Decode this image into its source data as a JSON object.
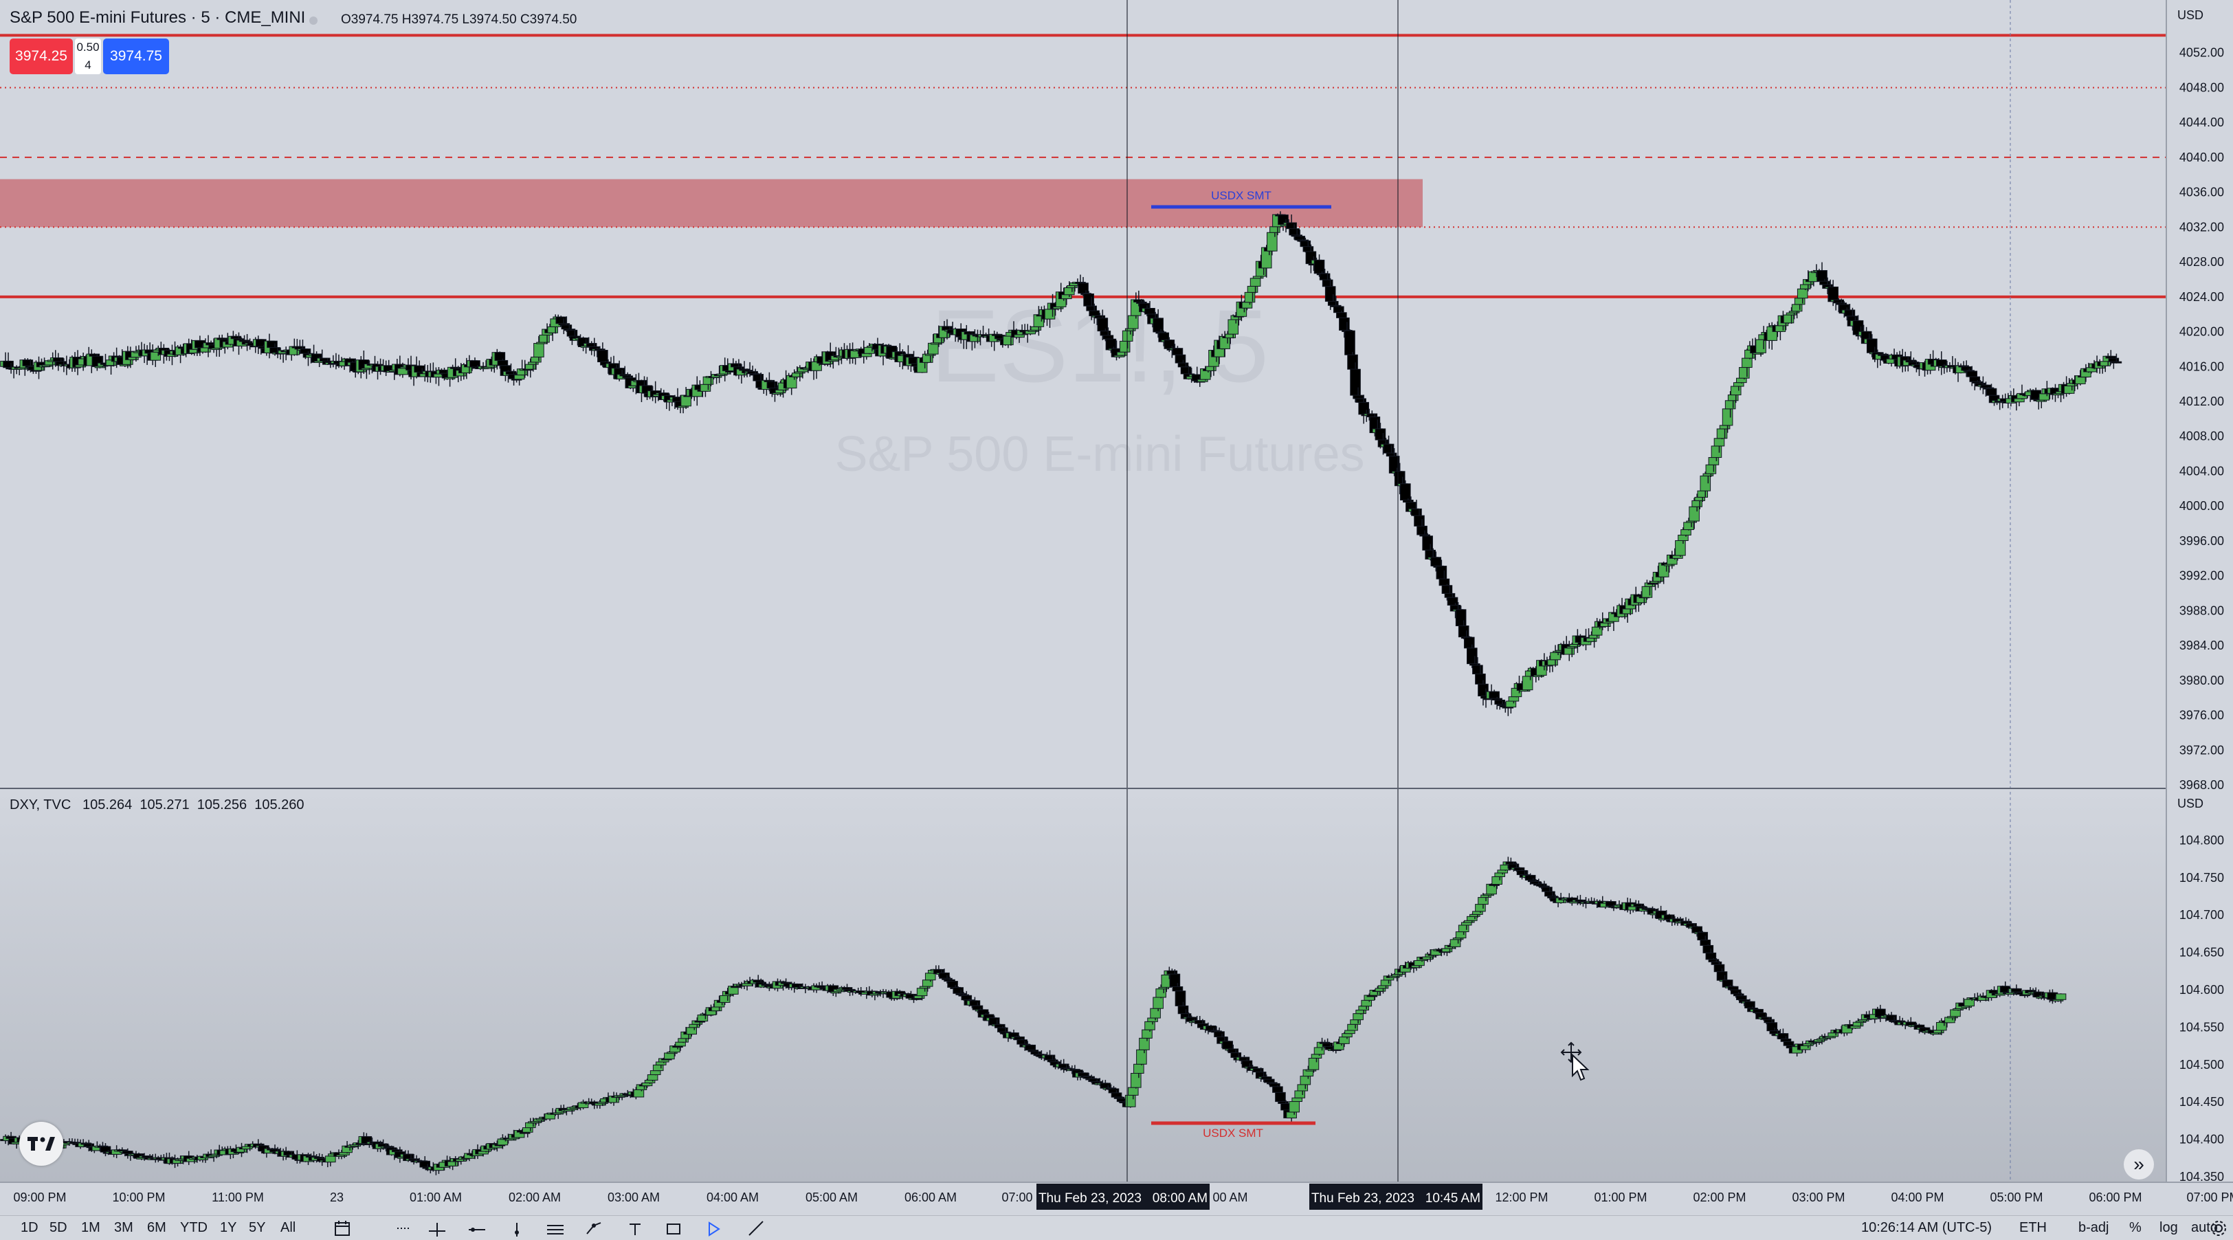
{
  "header": {
    "symbol_title": "S&P 500 E-mini Futures · 5 · CME_MINI",
    "ohlc": "O3974.75 H3974.75 L3974.50 C3974.50",
    "sell_price": "3974.25",
    "spread_top": "0.50",
    "spread_bottom": "4",
    "buy_price": "3974.75"
  },
  "watermark": {
    "ticker": "ES1!, 5",
    "name": "S&P 500 E-mini Futures"
  },
  "main_axis": {
    "currency": "USD",
    "ticks": [
      "4052.00",
      "4048.00",
      "4044.00",
      "4040.00",
      "4036.00",
      "4032.00",
      "4028.00",
      "4024.00",
      "4020.00",
      "4016.00",
      "4012.00",
      "4008.00",
      "4004.00",
      "4000.00",
      "3996.00",
      "3992.00",
      "3988.00",
      "3984.00",
      "3980.00",
      "3976.00",
      "3972.00",
      "3968.00"
    ]
  },
  "sub_pane": {
    "title": "DXY, TVC   105.264  105.271  105.256  105.260",
    "currency": "USD",
    "ticks": [
      "104.800",
      "104.750",
      "104.700",
      "104.650",
      "104.600",
      "104.550",
      "104.500",
      "104.450",
      "104.400",
      "104.350"
    ]
  },
  "annotations": {
    "main_label": "USDX SMT",
    "sub_label": "USDX SMT"
  },
  "time_axis": {
    "labels": [
      "09:00 PM",
      "10:00 PM",
      "11:00 PM",
      "23",
      "01:00 AM",
      "02:00 AM",
      "03:00 AM",
      "04:00 AM",
      "05:00 AM",
      "06:00 AM",
      "07:00",
      "00 AM",
      "12:00 PM",
      "01:00 PM",
      "02:00 PM",
      "03:00 PM",
      "04:00 PM",
      "05:00 PM",
      "06:00 PM",
      "07:00 PM"
    ],
    "crosshair_1": "Thu Feb 23, 2023   08:00 AM",
    "crosshair_2": "Thu Feb 23, 2023   10:45 AM"
  },
  "bottom_bar": {
    "timeframes": [
      "1D",
      "5D",
      "1M",
      "3M",
      "6M",
      "YTD",
      "1Y",
      "5Y",
      "All"
    ],
    "clock": "10:26:14 AM (UTC-5)",
    "session": "ETH",
    "badj": "b-adj",
    "percent": "%",
    "log": "log",
    "auto": "auto"
  },
  "colors": {
    "up": "#4caf50",
    "down": "#000000",
    "level_red": "#d32f2f",
    "zone": "#c9737b",
    "smt_blue": "#2a3fd8"
  },
  "chart_data": [
    {
      "type": "candlestick",
      "series_name": "S&P 500 E-mini Futures",
      "ylim": [
        3968,
        4056
      ],
      "levels": [
        4054,
        4024
      ],
      "dotted_levels": [
        4048,
        4032
      ],
      "dashed_levels": [
        4040
      ],
      "zone": [
        4032,
        4037.5
      ],
      "path": [
        [
          0,
          4016
        ],
        [
          45,
          4017
        ],
        [
          85,
          4019
        ],
        [
          100,
          4018
        ],
        [
          130,
          4016
        ],
        [
          160,
          4015
        ],
        [
          178,
          4017
        ],
        [
          185,
          4014
        ],
        [
          200,
          4022
        ],
        [
          205,
          4020
        ],
        [
          226,
          4014
        ],
        [
          244,
          4012
        ],
        [
          262,
          4016
        ],
        [
          279,
          4013
        ],
        [
          295,
          4017
        ],
        [
          317,
          4018
        ],
        [
          330,
          4016
        ],
        [
          338,
          4020
        ],
        [
          362,
          4019
        ],
        [
          376,
          4022
        ],
        [
          386,
          4026
        ],
        [
          393,
          4022
        ],
        [
          402,
          4017
        ],
        [
          409,
          4024
        ],
        [
          425,
          4016
        ],
        [
          430,
          4014
        ],
        [
          445,
          4022
        ],
        [
          454,
          4028
        ],
        [
          459,
          4033
        ],
        [
          463,
          4032
        ],
        [
          474,
          4027
        ],
        [
          484,
          4020
        ],
        [
          487,
          4013
        ],
        [
          499,
          4006
        ],
        [
          512,
          3996
        ],
        [
          524,
          3988
        ],
        [
          532,
          3979
        ],
        [
          540,
          3977
        ],
        [
          555,
          3982
        ],
        [
          570,
          3985
        ],
        [
          592,
          3990
        ],
        [
          605,
          3996
        ],
        [
          614,
          4004
        ],
        [
          628,
          4017
        ],
        [
          646,
          4023
        ],
        [
          653,
          4027
        ],
        [
          661,
          4023
        ],
        [
          676,
          4017
        ],
        [
          700,
          4016
        ],
        [
          710,
          4015
        ],
        [
          717,
          4012
        ],
        [
          740,
          4013
        ],
        [
          760,
          4017
        ]
      ]
    },
    {
      "type": "candlestick",
      "series_name": "DXY",
      "ylim": [
        104.35,
        104.85
      ],
      "path": [
        [
          0,
          104.4
        ],
        [
          30,
          104.39
        ],
        [
          60,
          104.37
        ],
        [
          90,
          104.39
        ],
        [
          115,
          104.37
        ],
        [
          130,
          104.4
        ],
        [
          155,
          104.36
        ],
        [
          182,
          104.4
        ],
        [
          200,
          104.44
        ],
        [
          228,
          104.46
        ],
        [
          248,
          104.55
        ],
        [
          266,
          104.61
        ],
        [
          305,
          104.6
        ],
        [
          330,
          104.59
        ],
        [
          335,
          104.63
        ],
        [
          346,
          104.59
        ],
        [
          362,
          104.54
        ],
        [
          385,
          104.49
        ],
        [
          398,
          104.47
        ],
        [
          405,
          104.44
        ],
        [
          410,
          104.52
        ],
        [
          420,
          104.63
        ],
        [
          426,
          104.56
        ],
        [
          434,
          104.55
        ],
        [
          448,
          104.5
        ],
        [
          458,
          104.47
        ],
        [
          463,
          104.43
        ],
        [
          475,
          104.53
        ],
        [
          480,
          104.52
        ],
        [
          490,
          104.58
        ],
        [
          500,
          104.62
        ],
        [
          522,
          104.66
        ],
        [
          542,
          104.77
        ],
        [
          560,
          104.72
        ],
        [
          590,
          104.71
        ],
        [
          610,
          104.68
        ],
        [
          620,
          104.61
        ],
        [
          645,
          104.52
        ],
        [
          665,
          104.55
        ],
        [
          675,
          104.57
        ],
        [
          695,
          104.54
        ],
        [
          705,
          104.58
        ],
        [
          720,
          104.6
        ],
        [
          740,
          104.59
        ]
      ]
    }
  ]
}
